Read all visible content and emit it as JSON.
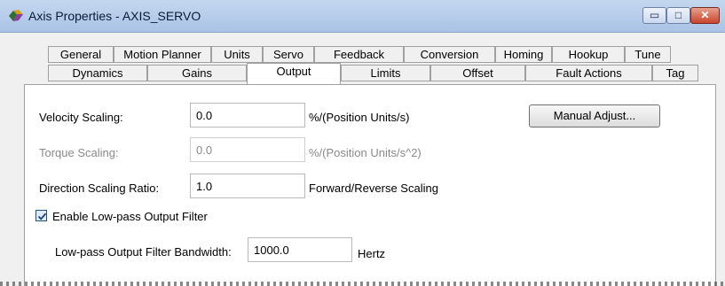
{
  "window": {
    "title": "Axis Properties - AXIS_SERVO"
  },
  "tabs_row1": [
    "General",
    "Motion Planner",
    "Units",
    "Servo",
    "Feedback",
    "Conversion",
    "Homing",
    "Hookup",
    "Tune"
  ],
  "tabs_row2": [
    "Dynamics",
    "Gains",
    "Output",
    "Limits",
    "Offset",
    "Fault Actions",
    "Tag"
  ],
  "selected_tab": "Output",
  "form": {
    "velocity_scaling": {
      "label": "Velocity Scaling:",
      "value": "0.0",
      "units": "%/(Position Units/s)"
    },
    "torque_scaling": {
      "label": "Torque Scaling:",
      "value": "0.0",
      "units": "%/(Position Units/s^2)"
    },
    "direction_scaling": {
      "label": "Direction Scaling Ratio:",
      "value": "1.0",
      "units": "Forward/Reverse Scaling"
    },
    "enable_filter": {
      "label": "Enable Low-pass Output Filter",
      "checked": true
    },
    "filter_bandwidth": {
      "label": "Low-pass Output Filter Bandwidth:",
      "value": "1000.0",
      "units": "Hertz"
    },
    "manual_adjust": "Manual Adjust..."
  },
  "icons": {
    "app": "axis-properties-icon",
    "minimize": "minimize-icon",
    "maximize": "maximize-icon",
    "close": "close-icon",
    "check": "check-icon"
  }
}
